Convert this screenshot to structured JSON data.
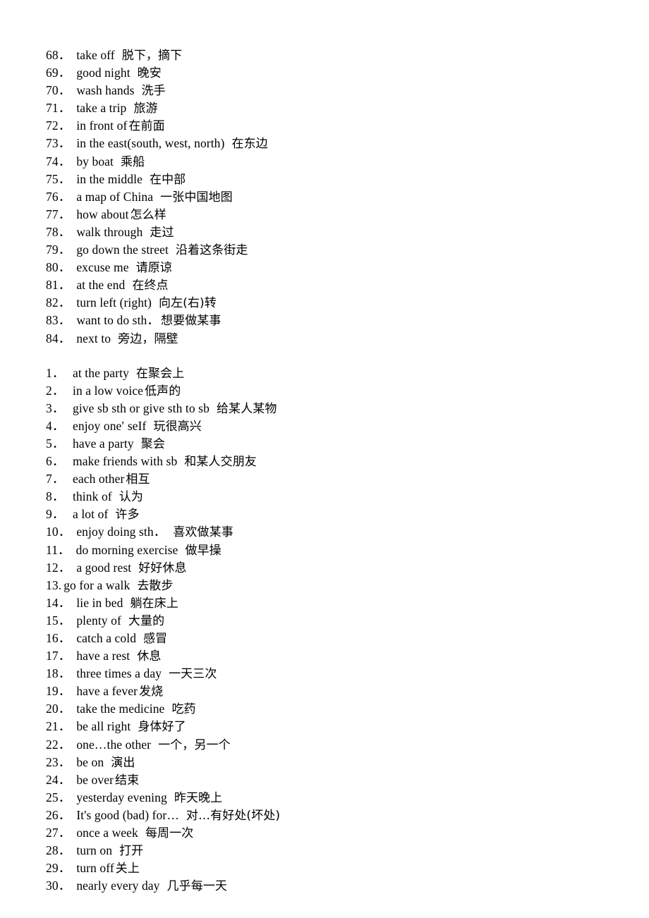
{
  "document": {
    "title": "English Phrases with Chinese Meanings",
    "background_color": "#ffffff",
    "text_color": "#000000"
  },
  "lists": [
    {
      "name": "phrase-list-continued",
      "items": [
        {
          "number": "68．",
          "english": "take off",
          "chinese": "脱下，摘下",
          "gap": "wide"
        },
        {
          "number": "69．",
          "english": "good night",
          "chinese": "晚安",
          "gap": "wide"
        },
        {
          "number": "70．",
          "english": "wash hands",
          "chinese": "洗手",
          "gap": "wide"
        },
        {
          "number": "71．",
          "english": "take a trip",
          "chinese": "旅游",
          "gap": "wide"
        },
        {
          "number": "72．",
          "english": "in front of",
          "chinese": "在前面",
          "gap": "narrow"
        },
        {
          "number": "73．",
          "english": "in the east(south, west, north)",
          "chinese": "在东边",
          "gap": "wide"
        },
        {
          "number": "74．",
          "english": "by boat",
          "chinese": "乘船",
          "gap": "wide"
        },
        {
          "number": "75．",
          "english": "in the middle",
          "chinese": "在中部",
          "gap": "wide"
        },
        {
          "number": "76．",
          "english": "a map of China",
          "chinese": "一张中国地图",
          "gap": "wide"
        },
        {
          "number": "77．",
          "english": "how about",
          "chinese": "怎么样",
          "gap": "narrow"
        },
        {
          "number": "78．",
          "english": "walk through",
          "chinese": "走过",
          "gap": "wide"
        },
        {
          "number": "79．",
          "english": "go down the street",
          "chinese": "沿着这条街走",
          "gap": "wide"
        },
        {
          "number": "80．",
          "english": "excuse me",
          "chinese": "请原谅",
          "gap": "wide"
        },
        {
          "number": "81．",
          "english": "at the end",
          "chinese": "在终点",
          "gap": "wide"
        },
        {
          "number": "82．",
          "english": "turn left (right)",
          "chinese": "向左(右)转",
          "gap": "wide"
        },
        {
          "number": "83．",
          "english": "want to do sth．",
          "chinese": "想要做某事",
          "gap": "narrow"
        },
        {
          "number": "84．",
          "english": "next to",
          "chinese": "旁边，隔壁",
          "gap": "wide"
        }
      ]
    },
    {
      "name": "phrase-list-unit",
      "items": [
        {
          "number": "1．",
          "english": "at the party",
          "chinese": "在聚会上",
          "gap": "wide"
        },
        {
          "number": "2．",
          "english": "in a low voice",
          "chinese": "低声的",
          "gap": "narrow"
        },
        {
          "number": "3．",
          "english": "give sb sth or give sth to sb",
          "chinese": "给某人某物",
          "gap": "wide"
        },
        {
          "number": "4．",
          "english": "enjoy one′ seIf",
          "chinese": "玩很高兴",
          "gap": "wide"
        },
        {
          "number": "5．",
          "english": "have a party",
          "chinese": "聚会",
          "gap": "wide"
        },
        {
          "number": "6．",
          "english": "make friends with sb",
          "chinese": "和某人交朋友",
          "gap": "wide"
        },
        {
          "number": "7．",
          "english": "each other",
          "chinese": "相互",
          "gap": "narrow"
        },
        {
          "number": "8．",
          "english": "think of",
          "chinese": "认为",
          "gap": "wide"
        },
        {
          "number": "9．",
          "english": "a lot of",
          "chinese": "许多",
          "gap": "wide"
        },
        {
          "number": "10．",
          "english": "enjoy doing sth．",
          "chinese": "喜欢做某事",
          "gap": "wide"
        },
        {
          "number": "11．",
          "english": "do morning exercise",
          "chinese": "做早操",
          "gap": "wide"
        },
        {
          "number": "12．",
          "english": "a good rest",
          "chinese": "好好休息",
          "gap": "wide"
        },
        {
          "number": "13.",
          "english": "go for a walk",
          "chinese": "去散步",
          "gap": "wide",
          "number_style": "tight",
          "gap_style": "tight"
        },
        {
          "number": "14．",
          "english": "lie in bed",
          "chinese": "躺在床上",
          "gap": "wide"
        },
        {
          "number": "15．",
          "english": "plenty of",
          "chinese": "大量的",
          "gap": "wide"
        },
        {
          "number": "16．",
          "english": "catch a cold",
          "chinese": "感冒",
          "gap": "wide"
        },
        {
          "number": "17．",
          "english": "have a rest",
          "chinese": "休息",
          "gap": "wide"
        },
        {
          "number": "18．",
          "english": "three times a day",
          "chinese": "一天三次",
          "gap": "wide"
        },
        {
          "number": "19．",
          "english": "have a fever",
          "chinese": "发烧",
          "gap": "narrow"
        },
        {
          "number": "20．",
          "english": "take the medicine",
          "chinese": "吃药",
          "gap": "wide"
        },
        {
          "number": "21．",
          "english": "be all right",
          "chinese": "身体好了",
          "gap": "wide"
        },
        {
          "number": "22．",
          "english": "one…the other",
          "chinese": "一个，另一个",
          "gap": "wide"
        },
        {
          "number": "23．",
          "english": "be on",
          "chinese": "演出",
          "gap": "wide"
        },
        {
          "number": "24．",
          "english": "be over",
          "chinese": "结束",
          "gap": "narrow"
        },
        {
          "number": "25．",
          "english": "yesterday evening",
          "chinese": "昨天晚上",
          "gap": "wide"
        },
        {
          "number": "26．",
          "english": "It's good (bad) for…",
          "chinese": "对…有好处(坏处)",
          "gap": "wide"
        },
        {
          "number": "27．",
          "english": "once a week",
          "chinese": "每周一次",
          "gap": "wide"
        },
        {
          "number": "28．",
          "english": "turn on",
          "chinese": "打开",
          "gap": "wide"
        },
        {
          "number": "29．",
          "english": "turn off",
          "chinese": "关上",
          "gap": "narrow"
        },
        {
          "number": "30．",
          "english": "nearly every day",
          "chinese": "几乎每一天",
          "gap": "wide"
        }
      ]
    }
  ]
}
